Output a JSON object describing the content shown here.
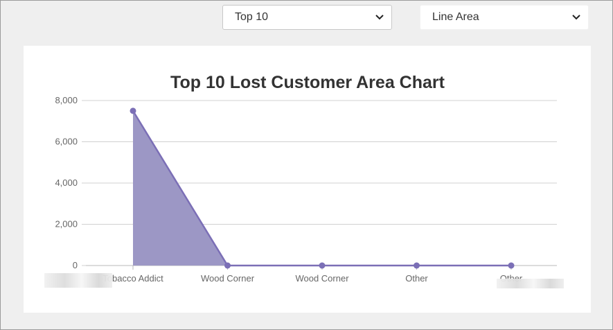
{
  "controls": {
    "range_select": {
      "value": "Top 10"
    },
    "chart_type_select": {
      "value": "Line Area"
    }
  },
  "colors": {
    "series": "#7b6fb6",
    "area_fill": "#9c97c5",
    "grid": "#d0d0d0"
  },
  "icons": {
    "dropdown": "chevron-down-icon"
  },
  "chart_data": {
    "type": "area",
    "title": "Top 10 Lost Customer Area Chart",
    "categories": [
      "Tobacco Addict",
      "Wood Corner",
      "Wood Corner",
      "Other",
      "Other"
    ],
    "series": [
      {
        "values": [
          7500,
          0,
          0,
          0,
          0
        ]
      }
    ],
    "ylim": [
      0,
      8000
    ],
    "yticks": [
      0,
      2000,
      4000,
      6000,
      8000
    ],
    "ytick_labels": [
      "0",
      "2,000",
      "4,000",
      "6,000",
      "8,000"
    ],
    "grid": true,
    "legend": "none"
  }
}
